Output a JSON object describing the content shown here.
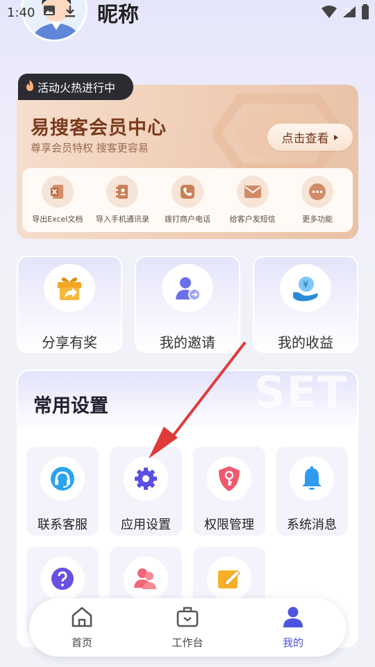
{
  "status_bar": {
    "time": "1:40"
  },
  "profile": {
    "nickname": "昵称"
  },
  "member_card": {
    "tag": "活动火热进行中",
    "title": "易搜客会员中心",
    "subtitle": "尊享会员特权 搜客更容易",
    "button_label": "点击查看",
    "functions": [
      {
        "label": "导出Excel文档",
        "icon": "excel-icon"
      },
      {
        "label": "导入手机通讯录",
        "icon": "contacts-book-icon"
      },
      {
        "label": "拨打商户电话",
        "icon": "phone-icon"
      },
      {
        "label": "给客户发短信",
        "icon": "envelope-icon"
      },
      {
        "label": "更多功能",
        "icon": "more-dots-icon"
      }
    ]
  },
  "quick_cards": [
    {
      "label": "分享有奖",
      "icon": "gift-share-icon"
    },
    {
      "label": "我的邀请",
      "icon": "user-invite-icon"
    },
    {
      "label": "我的收益",
      "icon": "yuan-coin-hand-icon"
    }
  ],
  "settings": {
    "title": "常用设置",
    "watermark": "SET",
    "items": [
      {
        "label": "联系客服",
        "icon": "headset-icon"
      },
      {
        "label": "应用设置",
        "icon": "gear-icon"
      },
      {
        "label": "权限管理",
        "icon": "shield-key-icon"
      },
      {
        "label": "系统消息",
        "icon": "bell-icon"
      },
      {
        "label": "",
        "icon": "question-icon"
      },
      {
        "label": "",
        "icon": "users-icon"
      },
      {
        "label": "",
        "icon": "edit-note-icon"
      }
    ]
  },
  "bottom_nav": [
    {
      "label": "首页",
      "icon": "home-icon",
      "active": false
    },
    {
      "label": "工作台",
      "icon": "briefcase-icon",
      "active": false
    },
    {
      "label": "我的",
      "icon": "person-icon",
      "active": true
    }
  ],
  "colors": {
    "accent": "#4c55e0",
    "member_brown": "#7a3a1c",
    "annotation_red": "#e03a3a"
  }
}
